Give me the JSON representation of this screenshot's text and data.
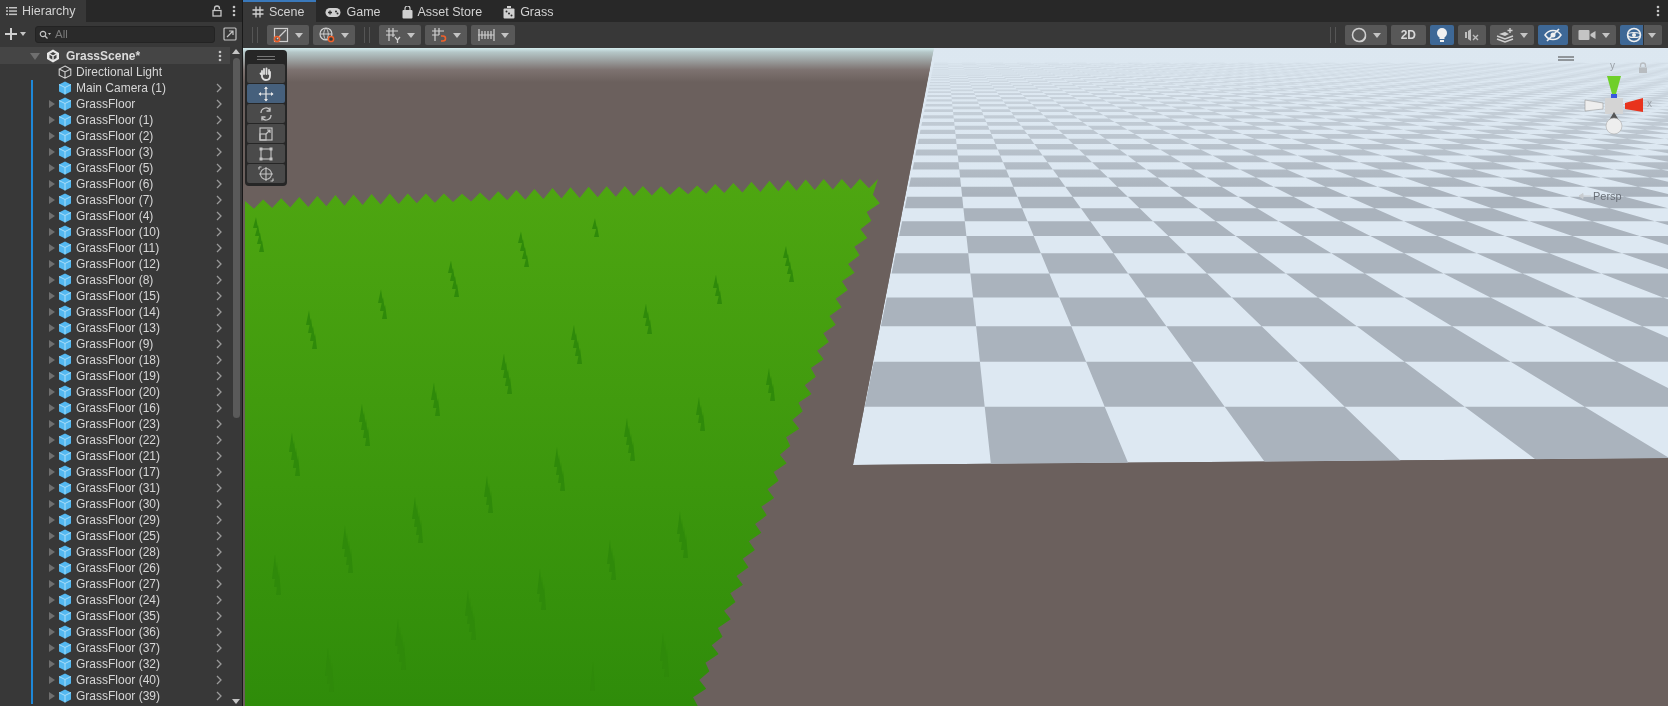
{
  "hierarchy": {
    "tab": "Hierarchy",
    "search": {
      "placeholder": "All"
    },
    "scene": {
      "name": "GrassScene*",
      "expanded": true
    },
    "items": [
      {
        "name": "Directional Light",
        "kind": "object",
        "expandable": false
      },
      {
        "name": "Main Camera (1)",
        "kind": "prefab",
        "expandable": false
      },
      {
        "name": "GrassFloor",
        "kind": "prefab",
        "expandable": true
      },
      {
        "name": "GrassFloor (1)",
        "kind": "prefab",
        "expandable": true
      },
      {
        "name": "GrassFloor (2)",
        "kind": "prefab",
        "expandable": true
      },
      {
        "name": "GrassFloor (3)",
        "kind": "prefab",
        "expandable": true
      },
      {
        "name": "GrassFloor (5)",
        "kind": "prefab",
        "expandable": true
      },
      {
        "name": "GrassFloor (6)",
        "kind": "prefab",
        "expandable": true
      },
      {
        "name": "GrassFloor (7)",
        "kind": "prefab",
        "expandable": true
      },
      {
        "name": "GrassFloor (4)",
        "kind": "prefab",
        "expandable": true
      },
      {
        "name": "GrassFloor (10)",
        "kind": "prefab",
        "expandable": true
      },
      {
        "name": "GrassFloor (11)",
        "kind": "prefab",
        "expandable": true
      },
      {
        "name": "GrassFloor (12)",
        "kind": "prefab",
        "expandable": true
      },
      {
        "name": "GrassFloor (8)",
        "kind": "prefab",
        "expandable": true
      },
      {
        "name": "GrassFloor (15)",
        "kind": "prefab",
        "expandable": true
      },
      {
        "name": "GrassFloor (14)",
        "kind": "prefab",
        "expandable": true
      },
      {
        "name": "GrassFloor (13)",
        "kind": "prefab",
        "expandable": true
      },
      {
        "name": "GrassFloor (9)",
        "kind": "prefab",
        "expandable": true
      },
      {
        "name": "GrassFloor (18)",
        "kind": "prefab",
        "expandable": true
      },
      {
        "name": "GrassFloor (19)",
        "kind": "prefab",
        "expandable": true
      },
      {
        "name": "GrassFloor (20)",
        "kind": "prefab",
        "expandable": true
      },
      {
        "name": "GrassFloor (16)",
        "kind": "prefab",
        "expandable": true
      },
      {
        "name": "GrassFloor (23)",
        "kind": "prefab",
        "expandable": true
      },
      {
        "name": "GrassFloor (22)",
        "kind": "prefab",
        "expandable": true
      },
      {
        "name": "GrassFloor (21)",
        "kind": "prefab",
        "expandable": true
      },
      {
        "name": "GrassFloor (17)",
        "kind": "prefab",
        "expandable": true
      },
      {
        "name": "GrassFloor (31)",
        "kind": "prefab",
        "expandable": true
      },
      {
        "name": "GrassFloor (30)",
        "kind": "prefab",
        "expandable": true
      },
      {
        "name": "GrassFloor (29)",
        "kind": "prefab",
        "expandable": true
      },
      {
        "name": "GrassFloor (25)",
        "kind": "prefab",
        "expandable": true
      },
      {
        "name": "GrassFloor (28)",
        "kind": "prefab",
        "expandable": true
      },
      {
        "name": "GrassFloor (26)",
        "kind": "prefab",
        "expandable": true
      },
      {
        "name": "GrassFloor (27)",
        "kind": "prefab",
        "expandable": true
      },
      {
        "name": "GrassFloor (24)",
        "kind": "prefab",
        "expandable": true
      },
      {
        "name": "GrassFloor (35)",
        "kind": "prefab",
        "expandable": true
      },
      {
        "name": "GrassFloor (36)",
        "kind": "prefab",
        "expandable": true
      },
      {
        "name": "GrassFloor (37)",
        "kind": "prefab",
        "expandable": true
      },
      {
        "name": "GrassFloor (32)",
        "kind": "prefab",
        "expandable": true
      },
      {
        "name": "GrassFloor (40)",
        "kind": "prefab",
        "expandable": true
      },
      {
        "name": "GrassFloor (39)",
        "kind": "prefab",
        "expandable": true
      }
    ]
  },
  "tabs": [
    {
      "label": "Scene",
      "kind": "scene",
      "selected": true
    },
    {
      "label": "Game",
      "kind": "game",
      "selected": false
    },
    {
      "label": "Asset Store",
      "kind": "store",
      "selected": false
    },
    {
      "label": "Grass",
      "kind": "window",
      "selected": false
    }
  ],
  "scene_toolbar": {
    "left_groups": [
      [
        {
          "kind": "handle-position",
          "dropdown": true
        },
        {
          "kind": "global",
          "dropdown": true
        }
      ],
      [
        {
          "kind": "grid",
          "dropdown": true
        },
        {
          "kind": "snap",
          "dropdown": true
        },
        {
          "kind": "increment",
          "dropdown": true
        }
      ]
    ],
    "right": [
      {
        "kind": "shading",
        "on": false,
        "dropdown": true
      },
      {
        "kind": "mode",
        "label": "2D",
        "on": false,
        "dropdown": false
      },
      {
        "kind": "lighting",
        "on": true,
        "dropdown": false
      },
      {
        "kind": "audio",
        "on": false,
        "dropdown": false
      },
      {
        "kind": "effects",
        "on": false,
        "dropdown": true
      },
      {
        "kind": "visibility",
        "on": true,
        "dropdown": false
      },
      {
        "kind": "camera",
        "on": false,
        "dropdown": true
      },
      {
        "kind": "gizmos",
        "on": true,
        "dropdown": true
      }
    ]
  },
  "tool_palette": [
    {
      "kind": "hand",
      "selected": false
    },
    {
      "kind": "move",
      "selected": true
    },
    {
      "kind": "rotate",
      "selected": false
    },
    {
      "kind": "scale",
      "selected": false
    },
    {
      "kind": "rect",
      "selected": false
    },
    {
      "kind": "transform",
      "selected": false
    }
  ],
  "gizmo": {
    "y_label": "y",
    "x_label": "x",
    "projection": "Persp"
  }
}
